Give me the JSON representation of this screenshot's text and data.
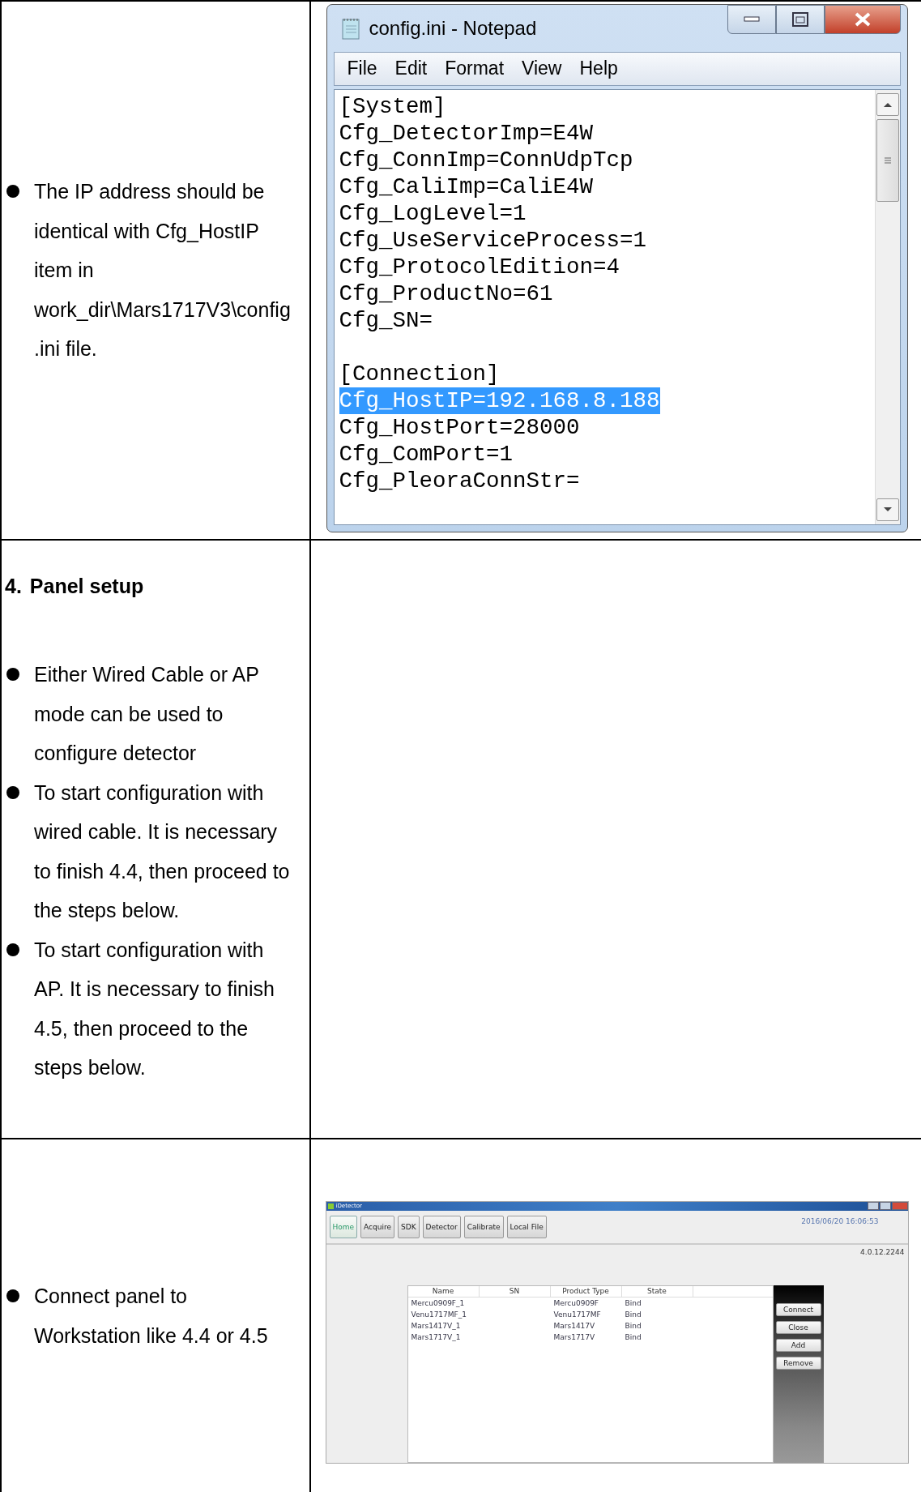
{
  "rows": [
    {
      "left": {
        "bullets": [
          "The IP address should be identical with Cfg_HostIP item in work_dir\\Mars1717V3\\config.ini file."
        ]
      },
      "right": {
        "kind": "notepad",
        "title": "config.ini - Notepad",
        "menu": [
          "File",
          "Edit",
          "Format",
          "View",
          "Help"
        ],
        "sections": [
          {
            "lines": [
              {
                "text": "[System]",
                "selected": false
              },
              {
                "text": "Cfg_DetectorImp=E4W",
                "selected": false
              },
              {
                "text": "Cfg_ConnImp=ConnUdpTcp",
                "selected": false
              },
              {
                "text": "Cfg_CaliImp=CaliE4W",
                "selected": false
              },
              {
                "text": "Cfg_LogLevel=1",
                "selected": false
              },
              {
                "text": "Cfg_UseServiceProcess=1",
                "selected": false
              },
              {
                "text": "Cfg_ProtocolEdition=4",
                "selected": false
              },
              {
                "text": "Cfg_ProductNo=61",
                "selected": false
              },
              {
                "text": "Cfg_SN=",
                "selected": false
              }
            ]
          },
          {
            "lines": [
              {
                "text": "[Connection]",
                "selected": false
              },
              {
                "text": "Cfg_HostIP=192.168.8.188",
                "selected": true
              },
              {
                "text": "Cfg_HostPort=28000",
                "selected": false
              },
              {
                "text": "Cfg_ComPort=1",
                "selected": false
              },
              {
                "text": "Cfg_PleoraConnStr=",
                "selected": false
              }
            ]
          }
        ]
      }
    },
    {
      "left": {
        "number": "4.",
        "heading": "Panel setup",
        "bullets": [
          "Either Wired Cable or AP mode can be used to configure detector",
          "To start configuration with wired cable. It is necessary to finish 4.4, then proceed to the steps below.",
          "To start configuration with AP. It is necessary to finish 4.5, then proceed to the steps below."
        ]
      }
    },
    {
      "left": {
        "bullets": [
          "Connect panel to Workstation like 4.4 or 4.5"
        ]
      },
      "right": {
        "kind": "app",
        "title": "iDetector",
        "tabs": [
          {
            "label": "Home",
            "selected": true
          },
          {
            "label": "Acquire",
            "selected": false
          },
          {
            "label": "SDK",
            "selected": false
          },
          {
            "label": "Detector",
            "selected": false
          },
          {
            "label": "Calibrate",
            "selected": false
          },
          {
            "label": "Local File",
            "selected": false
          }
        ],
        "datetime": "2016/06/20 16:06:53",
        "version": "4.0.12.2244",
        "columns": [
          "Name",
          "SN",
          "Product Type",
          "State"
        ],
        "devices": [
          {
            "name": "Mercu0909F_1",
            "product_type": "Mercu0909F",
            "state": "Bind"
          },
          {
            "name": "Venu1717MF_1",
            "product_type": "Venu1717MF",
            "state": "Bind"
          },
          {
            "name": "Mars1417V_1",
            "product_type": "Mars1417V",
            "state": "Bind"
          },
          {
            "name": "Mars1717V_1",
            "product_type": "Mars1717V",
            "state": "Bind"
          }
        ],
        "buttons": [
          "Connect",
          "Close",
          "Add",
          "Remove"
        ]
      }
    }
  ]
}
